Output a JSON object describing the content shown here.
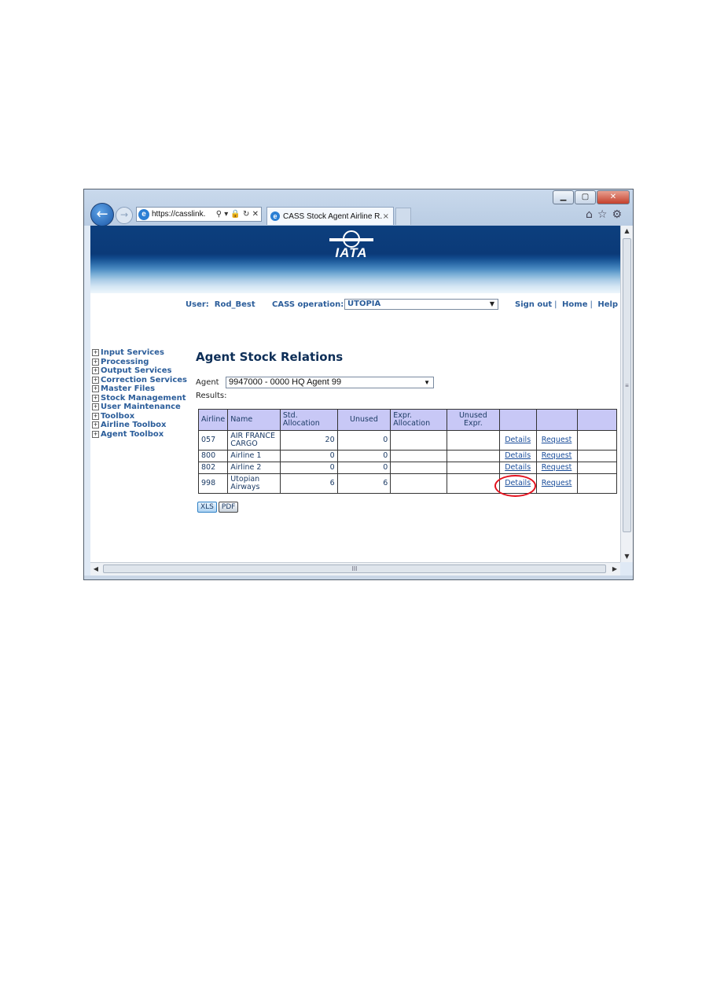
{
  "browser": {
    "address_url": "https://casslink.",
    "address_controls": "⚲ ▾ 🔒 ↻ ✕",
    "tab_title": "CASS Stock Agent Airline R...",
    "tab_close": "×",
    "window_buttons": {
      "minimize": "▁",
      "restore": "▢",
      "close": "✕"
    },
    "toolbar_icons": "⌂☆⚙",
    "scroll_glyph": "≡",
    "hscroll_glyph": "III"
  },
  "header": {
    "logo_text": "IATA",
    "user_label": "User:",
    "user_name": "Rod_Best",
    "operation_label": "CASS operation:",
    "operation_value": "UTOPIA",
    "links": {
      "sign_out": "Sign out",
      "home": "Home",
      "help": "Help",
      "separator": "|"
    }
  },
  "menu": [
    {
      "label": "Input Services"
    },
    {
      "label": "Processing"
    },
    {
      "label": "Output Services"
    },
    {
      "label": "Correction Services"
    },
    {
      "label": "Master Files"
    },
    {
      "label": "Stock Management"
    },
    {
      "label": "User Maintenance"
    },
    {
      "label": "Toolbox"
    },
    {
      "label": "Airline Toolbox"
    },
    {
      "label": "Agent Toolbox"
    }
  ],
  "menu_expand_glyph": "+",
  "page": {
    "title": "Agent Stock Relations",
    "agent_label": "Agent",
    "agent_value": "9947000 - 0000 HQ Agent 99",
    "results_label": "Results:"
  },
  "table": {
    "headers": {
      "airline": "Airline",
      "name": "Name",
      "std_allocation_1": "Std.",
      "std_allocation_2": "Allocation",
      "unused": "Unused",
      "expr_allocation_1": "Expr.",
      "expr_allocation_2": "Allocation",
      "unused_expr_1": "Unused",
      "unused_expr_2": "Expr."
    },
    "rows": [
      {
        "airline": "057",
        "name_1": "AIR FRANCE",
        "name_2": "CARGO",
        "std_allocation": "20",
        "unused": "0",
        "expr_allocation": "",
        "unused_expr": "",
        "details": "Details",
        "request": "Request"
      },
      {
        "airline": "800",
        "name_1": "Airline 1",
        "name_2": "",
        "std_allocation": "0",
        "unused": "0",
        "expr_allocation": "",
        "unused_expr": "",
        "details": "Details",
        "request": "Request"
      },
      {
        "airline": "802",
        "name_1": "Airline 2",
        "name_2": "",
        "std_allocation": "0",
        "unused": "0",
        "expr_allocation": "",
        "unused_expr": "",
        "details": "Details",
        "request": "Request"
      },
      {
        "airline": "998",
        "name_1": "Utopian",
        "name_2": "Airways",
        "std_allocation": "6",
        "unused": "6",
        "expr_allocation": "",
        "unused_expr": "",
        "details": "Details",
        "request": "Request"
      }
    ]
  },
  "export_buttons": {
    "xls": "XLS",
    "pdf": "PDF"
  },
  "colors": {
    "annotation_circle": "#e3121e",
    "banner_dark": "#0b3a78",
    "header_row": "#c8c8f6",
    "link": "#2b5d9a"
  }
}
